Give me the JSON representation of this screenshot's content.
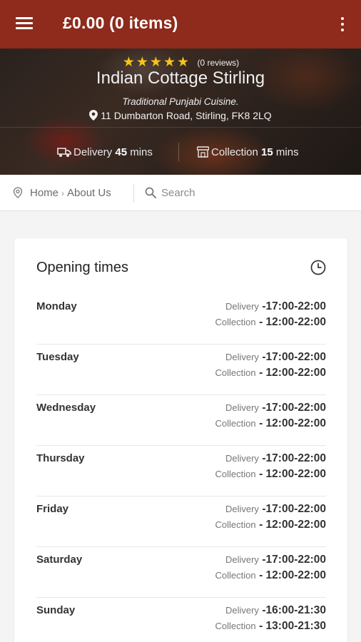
{
  "header": {
    "cart_summary": "£0.00 (0 items)"
  },
  "hero": {
    "rating_stars": 5,
    "reviews": "(0 reviews)",
    "name": "Indian Cottage Stirling",
    "tagline": "Traditional Punjabi Cuisine.",
    "address": "11 Dumbarton Road, Stirling, FK8 2LQ",
    "delivery": {
      "label": "Delivery",
      "time": "45",
      "unit": "mins"
    },
    "collection": {
      "label": "Collection",
      "time": "15",
      "unit": "mins"
    }
  },
  "nav": {
    "breadcrumb": [
      "Home",
      "About Us"
    ],
    "separator": "›",
    "search_placeholder": "Search"
  },
  "opening_times": {
    "title": "Opening times",
    "delivery_label": "Delivery",
    "collection_label": "Collection",
    "days": [
      {
        "day": "Monday",
        "delivery": "-17:00-22:00",
        "collection": "- 12:00-22:00"
      },
      {
        "day": "Tuesday",
        "delivery": "-17:00-22:00",
        "collection": "- 12:00-22:00"
      },
      {
        "day": "Wednesday",
        "delivery": "-17:00-22:00",
        "collection": "- 12:00-22:00"
      },
      {
        "day": "Thursday",
        "delivery": "-17:00-22:00",
        "collection": "- 12:00-22:00"
      },
      {
        "day": "Friday",
        "delivery": "-17:00-22:00",
        "collection": "- 12:00-22:00"
      },
      {
        "day": "Saturday",
        "delivery": "-17:00-22:00",
        "collection": "- 12:00-22:00"
      },
      {
        "day": "Sunday",
        "delivery": "-16:00-21:30",
        "collection": "- 13:00-21:30"
      }
    ]
  },
  "colors": {
    "brand": "#8e2b1c",
    "star": "#f5c518"
  },
  "icons": [
    "menu-icon",
    "more-vert-icon",
    "star-icon",
    "location-pin-icon",
    "truck-icon",
    "store-icon",
    "search-icon",
    "clock-icon"
  ]
}
